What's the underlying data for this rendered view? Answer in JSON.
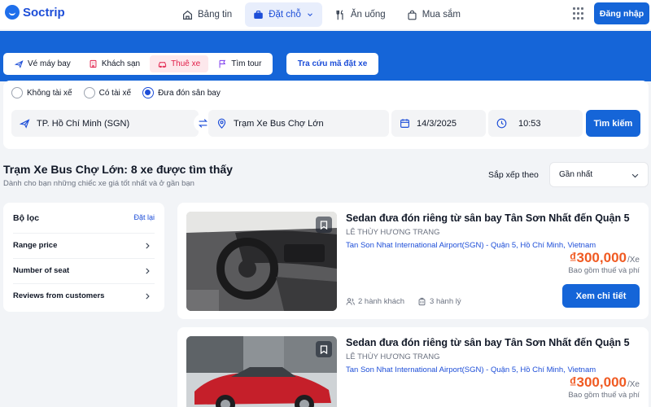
{
  "brand": {
    "name": "Soctrip"
  },
  "nav": [
    {
      "label": "Bảng tin",
      "icon": "home-icon",
      "active": false
    },
    {
      "label": "Đặt chỗ",
      "icon": "briefcase-icon",
      "active": true
    },
    {
      "label": "Ăn uống",
      "icon": "utensils-icon",
      "active": false
    },
    {
      "label": "Mua sắm",
      "icon": "shopping-bag-icon",
      "active": false
    }
  ],
  "header": {
    "login_label": "Đăng nhập"
  },
  "tabs": [
    {
      "label": "Vé máy bay",
      "icon": "plane-icon"
    },
    {
      "label": "Khách sạn",
      "icon": "hotel-icon"
    },
    {
      "label": "Thuê xe",
      "icon": "car-icon",
      "active": true
    },
    {
      "label": "Tìm tour",
      "icon": "flag-icon"
    }
  ],
  "lookup_label": "Tra cứu mã đặt xe",
  "search": {
    "options": [
      {
        "label": "Không tài xế",
        "checked": false
      },
      {
        "label": "Có tài xế",
        "checked": false
      },
      {
        "label": "Đưa đón sân bay",
        "checked": true
      }
    ],
    "from": "TP. Hồ Chí Minh (SGN)",
    "to": "Trạm Xe Bus Chợ Lớn",
    "date": "14/3/2025",
    "time": "10:53",
    "button": "Tìm kiếm"
  },
  "results": {
    "title": "Trạm Xe Bus Chợ Lớn: 8 xe được tìm thấy",
    "subtitle": "Dành cho bạn những chiếc xe giá tốt nhất và ở gần bạn",
    "sort_label": "Sắp xếp theo",
    "sort_value": "Gần nhất"
  },
  "filter": {
    "title": "Bộ lọc",
    "reset": "Đặt lại",
    "items": [
      "Range price",
      "Number of seat",
      "Reviews from customers"
    ]
  },
  "cards": [
    {
      "title": "Sedan đưa đón riêng từ sân bay Tân Sơn Nhất đến Quận 5",
      "driver": "LÊ THÙY HƯƠNG TRANG",
      "route": "Tan Son Nhat International Airport(SGN) - Quận 5, Hồ Chí Minh, Vietnam",
      "price": "₫300,000",
      "per": "/Xe",
      "tax": "Bao gồm thuế và phí",
      "passengers": "2 hành khách",
      "luggage": "3 hành lý",
      "button": "Xem chi tiết"
    },
    {
      "title": "Sedan đưa đón riêng từ sân bay Tân Sơn Nhất đến Quận 5",
      "driver": "LÊ THÙY HƯƠNG TRANG",
      "route": "Tan Son Nhat International Airport(SGN) - Quận 5, Hồ Chí Minh, Vietnam",
      "price": "₫300,000",
      "per": "/Xe",
      "tax": "Bao gồm thuế và phí"
    }
  ],
  "colors": {
    "primary": "#1565d8",
    "accent_price": "#f05a22",
    "active_tab": "#e11d48"
  }
}
